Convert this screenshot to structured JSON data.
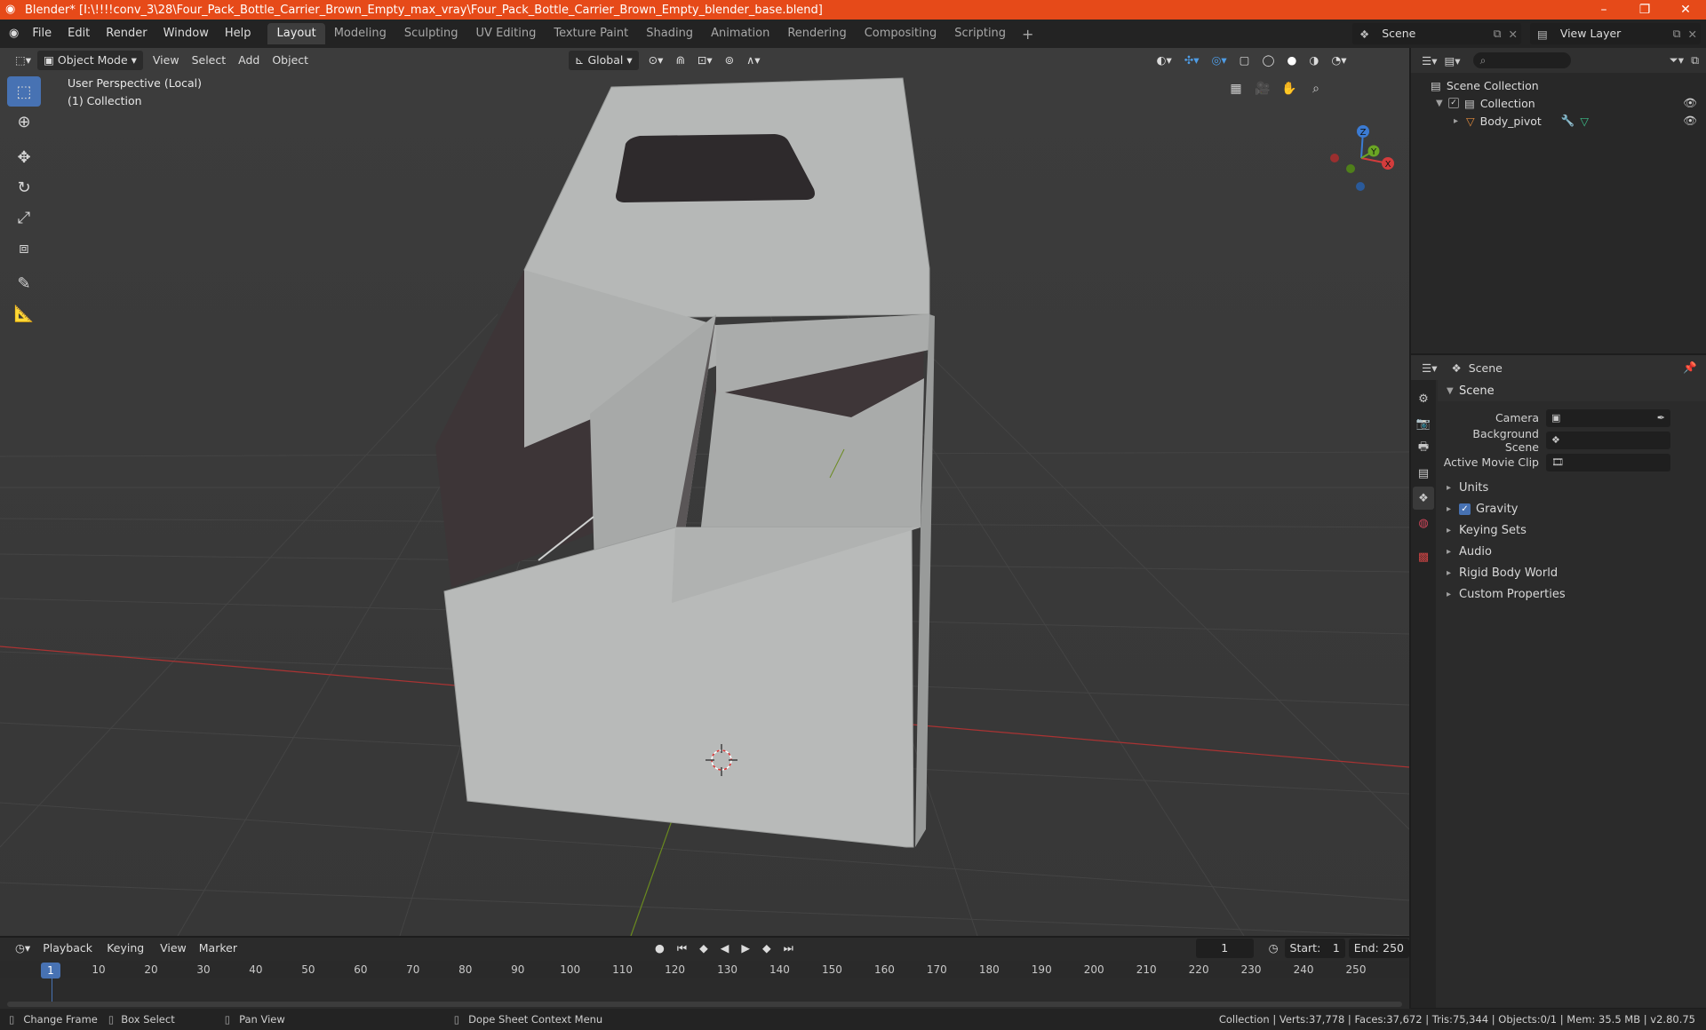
{
  "window": {
    "title": "Blender* [I:\\!!!!conv_3\\28\\Four_Pack_Bottle_Carrier_Brown_Empty_max_vray\\Four_Pack_Bottle_Carrier_Brown_Empty_blender_base.blend]",
    "minimize": "–",
    "maximize": "❐",
    "close": "✕"
  },
  "menu": {
    "items": [
      "File",
      "Edit",
      "Render",
      "Window",
      "Help"
    ]
  },
  "workspaces": [
    "Layout",
    "Modeling",
    "Sculpting",
    "UV Editing",
    "Texture Paint",
    "Shading",
    "Animation",
    "Rendering",
    "Compositing",
    "Scripting"
  ],
  "workspace_add": "+",
  "scene": {
    "name": "Scene",
    "view_layer": "View Layer"
  },
  "viewport": {
    "mode": "Object Mode",
    "menus": [
      "View",
      "Select",
      "Add",
      "Object"
    ],
    "orientation": "Global",
    "perspective_label": "User Perspective (Local)",
    "collection_label": "(1) Collection",
    "gizmo_axes": {
      "x": "X",
      "y": "Y",
      "z": "Z"
    }
  },
  "outliner": {
    "root": "Scene Collection",
    "collection": "Collection",
    "object": "Body_pivot"
  },
  "properties": {
    "header": "Scene",
    "panel": "Scene",
    "fields": [
      {
        "label": "Camera",
        "value": ""
      },
      {
        "label": "Background Scene",
        "value": ""
      },
      {
        "label": "Active Movie Clip",
        "value": ""
      }
    ],
    "subpanels": [
      "Units",
      "Gravity",
      "Keying Sets",
      "Audio",
      "Rigid Body World",
      "Custom Properties"
    ]
  },
  "timeline": {
    "menus": [
      "Playback",
      "Keying",
      "View",
      "Marker"
    ],
    "current_frame": "1",
    "start_label": "Start:",
    "start": "1",
    "end_label": "End:",
    "end": "250",
    "ticks": [
      "10",
      "20",
      "30",
      "40",
      "50",
      "60",
      "70",
      "80",
      "90",
      "100",
      "110",
      "120",
      "130",
      "140",
      "150",
      "160",
      "170",
      "180",
      "190",
      "200",
      "210",
      "220",
      "230",
      "240",
      "250"
    ],
    "playhead": "1"
  },
  "status": {
    "change_frame": "Change Frame",
    "box_select": "Box Select",
    "pan_view": "Pan View",
    "context_menu": "Dope Sheet Context Menu",
    "stats": "Collection | Verts:37,778 | Faces:37,672 | Tris:75,344 | Objects:0/1 | Mem: 35.5 MB | v2.80.75"
  },
  "colors": {
    "accent": "#4772b3",
    "title": "#e64a19",
    "viewport": "#3a3a3a",
    "model": "#b9bbba"
  }
}
